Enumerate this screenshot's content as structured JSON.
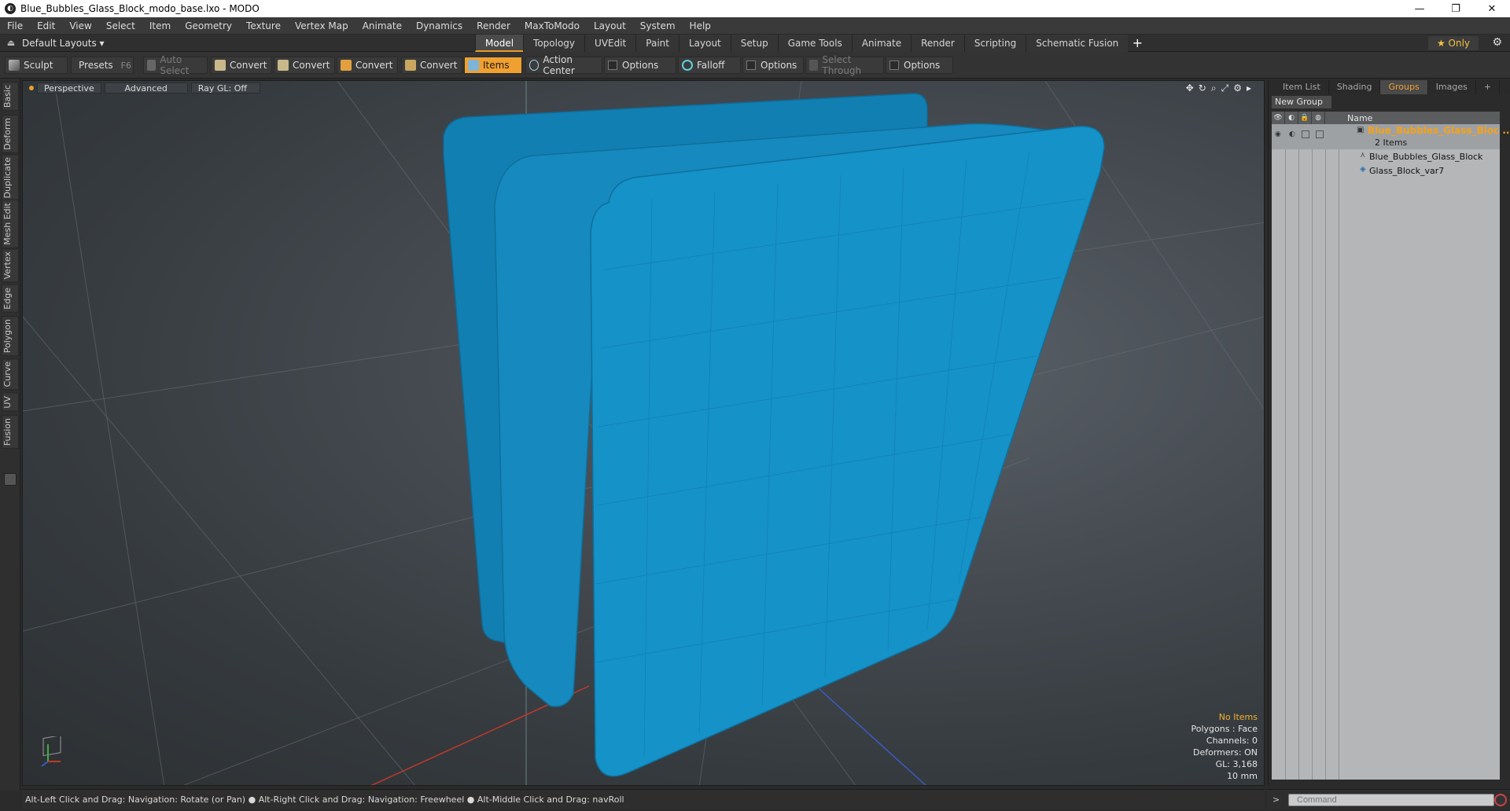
{
  "window": {
    "title": "Blue_Bubbles_Glass_Block_modo_base.lxo - MODO",
    "controls": [
      "—",
      "❐",
      "✕"
    ]
  },
  "menu": [
    "File",
    "Edit",
    "View",
    "Select",
    "Item",
    "Geometry",
    "Texture",
    "Vertex Map",
    "Animate",
    "Dynamics",
    "Render",
    "MaxToModo",
    "Layout",
    "System",
    "Help"
  ],
  "layouts": {
    "dropdown": "Default Layouts ▾",
    "tabs": [
      "Model",
      "Topology",
      "UVEdit",
      "Paint",
      "Layout",
      "Setup",
      "Game Tools",
      "Animate",
      "Render",
      "Scripting",
      "Schematic Fusion"
    ],
    "active_tab": "Model",
    "add": "+",
    "only": "★  Only"
  },
  "toolbar": {
    "sculpt": "Sculpt",
    "presets": "Presets",
    "presets_key": "F6",
    "auto_select": "Auto Select",
    "convert1": "Convert",
    "convert2": "Convert",
    "convert3": "Convert",
    "convert4": "Convert",
    "items": "Items",
    "action_center": "Action Center",
    "options1": "Options",
    "falloff": "Falloff",
    "options2": "Options",
    "select_through": "Select Through",
    "options3": "Options"
  },
  "left_tabs": [
    "Basic",
    "Deform",
    "Duplicate",
    "Mesh Edit",
    "Vertex",
    "Edge",
    "Polygon",
    "Curve",
    "UV",
    "Fusion"
  ],
  "viewport": {
    "perspective": "Perspective",
    "advanced": "Advanced",
    "raygl": "Ray GL: Off",
    "info": {
      "items": "No Items",
      "polygons": "Polygons : Face",
      "channels": "Channels: 0",
      "deformers": "Deformers: ON",
      "gl": "GL: 3,168",
      "scale": "10 mm"
    },
    "colors": {
      "mesh": "#1592c8",
      "mesh_edge": "#0f6f9c",
      "accent": "#f0a030"
    }
  },
  "status": "Alt-Left Click and Drag: Navigation: Rotate (or Pan) ● Alt-Right Click and Drag: Navigation: Freewheel ● Alt-Middle Click and Drag: navRoll",
  "right_panel": {
    "tabs": [
      "Item List",
      "Shading",
      "Groups",
      "Images",
      "+"
    ],
    "active_tab": "Groups",
    "new_group": "New Group",
    "column_name": "Name",
    "group": {
      "name": "Blue_Bubbles_Glass_Bloc ...",
      "count": "2 Items",
      "children": [
        "Blue_Bubbles_Glass_Block",
        "Glass_Block_var7"
      ]
    }
  },
  "command": {
    "prompt": ">",
    "placeholder": "Command"
  }
}
